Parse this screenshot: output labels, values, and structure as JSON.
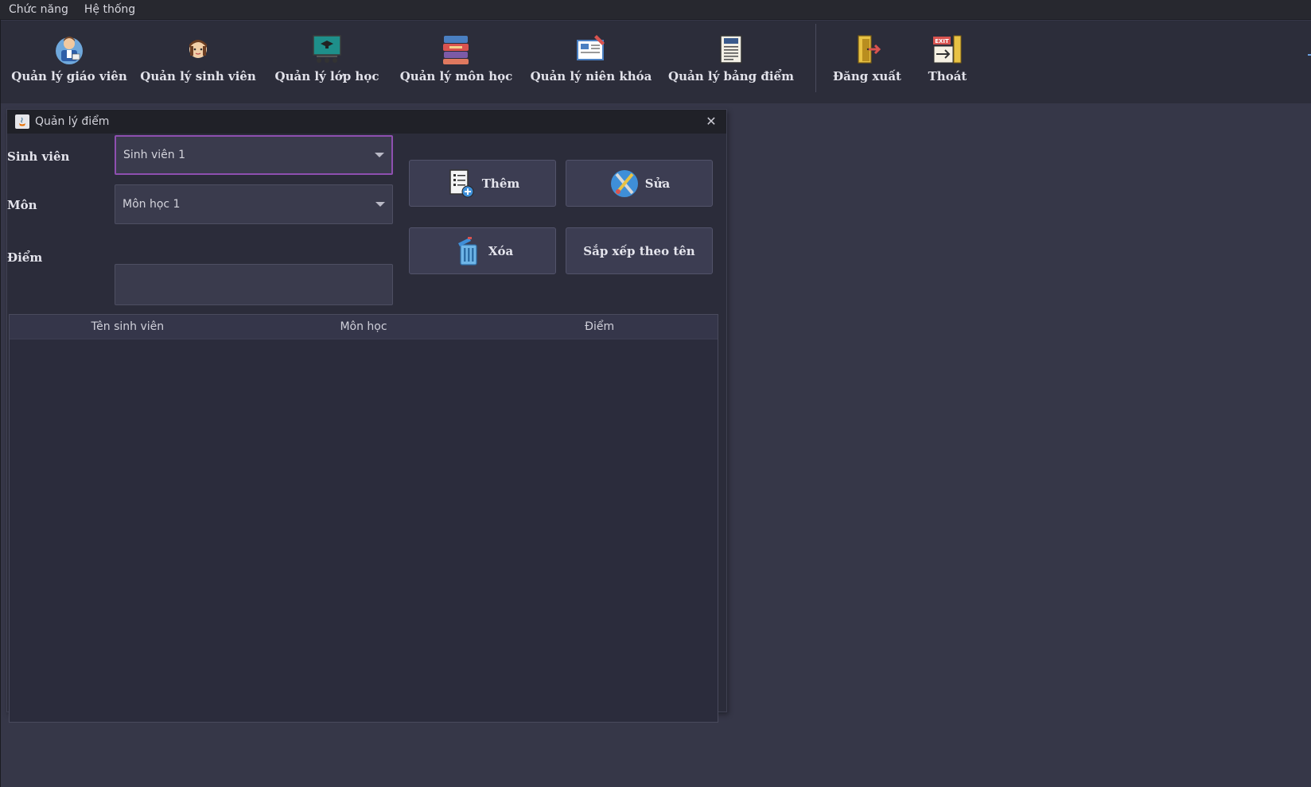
{
  "menubar": {
    "items": [
      "Chức năng",
      "Hệ thống"
    ]
  },
  "toolbar": {
    "buttons": [
      {
        "label": "Quản lý giáo viên",
        "icon": "teacher-icon"
      },
      {
        "label": "Quản lý sinh viên",
        "icon": "student-icon"
      },
      {
        "label": "Quản lý lớp học",
        "icon": "classroom-icon"
      },
      {
        "label": "Quản lý môn học",
        "icon": "books-icon"
      },
      {
        "label": "Quản lý niên khóa",
        "icon": "calendar-book-icon"
      },
      {
        "label": "Quản lý bảng điểm",
        "icon": "report-document-icon"
      },
      {
        "label": "Đăng xuất",
        "icon": "logout-door-icon"
      },
      {
        "label": "Thoát",
        "icon": "exit-sign-icon"
      }
    ]
  },
  "window": {
    "title": "Quản lý điểm",
    "close_icon": "close-icon"
  },
  "form": {
    "student_label": "Sinh viên",
    "student_value": "Sinh viên 1",
    "subject_label": "Môn",
    "subject_value": "Môn học 1",
    "score_label": "Điểm",
    "score_value": ""
  },
  "actions": {
    "add": "Thêm",
    "edit": "Sửa",
    "delete": "Xóa",
    "sort": "Sắp xếp theo tên"
  },
  "table": {
    "columns": [
      "Tên sinh viên",
      "Môn học",
      "Điểm"
    ],
    "rows": []
  },
  "colors": {
    "background": "#363748",
    "toolbar": "#2c2d3a",
    "focus_border": "#8e4fb0"
  }
}
